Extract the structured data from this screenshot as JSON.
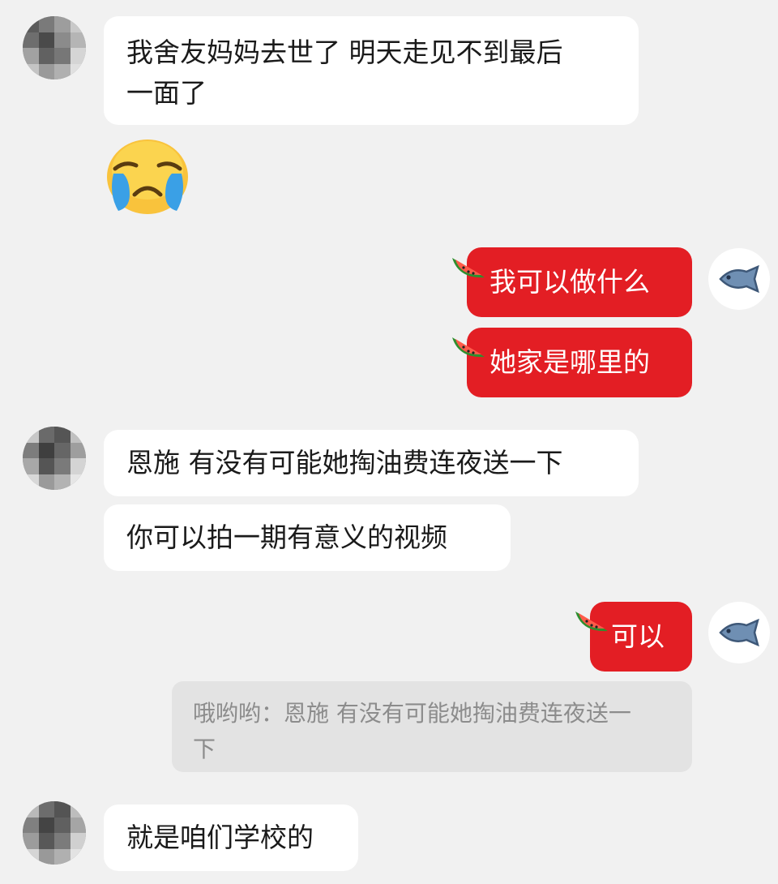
{
  "messages": {
    "m1": "我舍友妈妈去世了 明天走见不到最后一面了",
    "m1_line1": "我舍友妈妈去世了 明天走见不到最后",
    "m1_line2": "一面了",
    "m2_emoji": "crying-face-icon",
    "m3": "我可以做什么",
    "m4": "她家是哪里的",
    "m5": "恩施 有没有可能她掏油费连夜送一下",
    "m6": "你可以拍一期有意义的视频",
    "m7": "可以",
    "quote_line1": "哦哟哟：恩施 有没有可能她掏油费连夜送一",
    "quote_line2": "下",
    "m8": "就是咱们学校的"
  },
  "colors": {
    "background": "#f1f1f1",
    "incoming_bubble": "#ffffff",
    "outgoing_bubble": "#e31e24",
    "quote_bubble": "#e3e3e3",
    "quote_text": "#8c8c8c",
    "avatar_fish": "#6f8fb3"
  },
  "icons": {
    "outgoing_decoration": "watermelon-icon",
    "self_avatar": "fish-icon",
    "other_avatar": "pixelated-avatar"
  }
}
